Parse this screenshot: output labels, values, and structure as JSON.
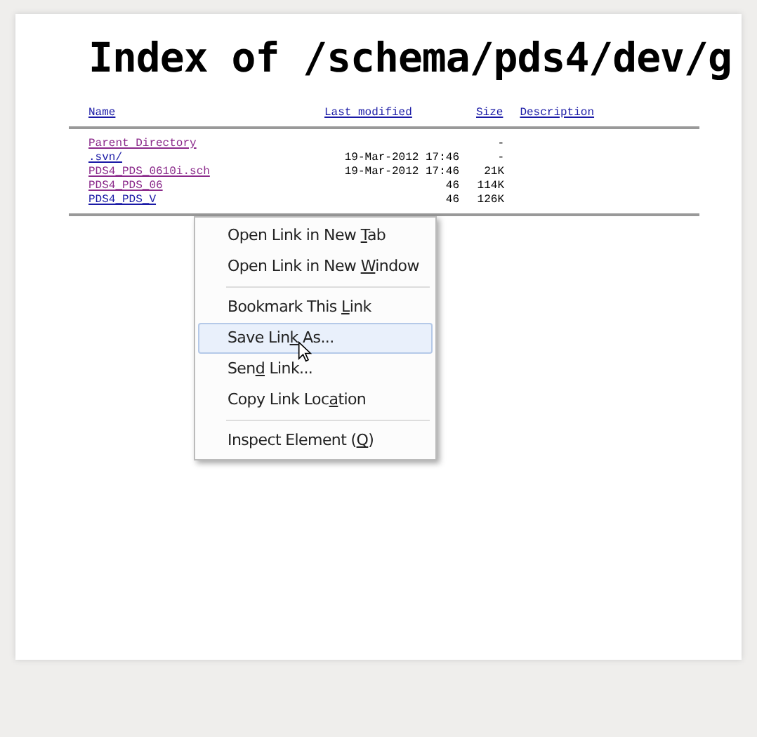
{
  "title": "Index of /schema/pds4/dev/g",
  "columns": [
    "Name",
    "Last modified",
    "Size",
    "Description"
  ],
  "rows": [
    {
      "name": "Parent Directory",
      "modified": "",
      "size": "-",
      "visited": true
    },
    {
      "name": ".svn/",
      "modified": "19-Mar-2012 17:46",
      "size": "-",
      "visited": false
    },
    {
      "name": "PDS4_PDS_0610i.sch",
      "modified": "19-Mar-2012 17:46",
      "size": "21K",
      "visited": true
    },
    {
      "name": "PDS4_PDS_06",
      "modified": "46",
      "size": "114K",
      "visited": true
    },
    {
      "name": "PDS4_PDS_V",
      "modified": "46",
      "size": "126K",
      "visited": false
    }
  ],
  "context_menu": [
    {
      "kind": "item",
      "label_before": "Open Link in New ",
      "accesskey": "T",
      "label_after": "ab",
      "selected": false
    },
    {
      "kind": "item",
      "label_before": "Open Link in New ",
      "accesskey": "W",
      "label_after": "indow",
      "selected": false
    },
    {
      "kind": "separator"
    },
    {
      "kind": "item",
      "label_before": "Bookmark This ",
      "accesskey": "L",
      "label_after": "ink",
      "selected": false
    },
    {
      "kind": "item",
      "label_before": "Save Lin",
      "accesskey": "k",
      "label_after": " As...",
      "selected": true
    },
    {
      "kind": "item",
      "label_before": "Sen",
      "accesskey": "d",
      "label_after": " Link...",
      "selected": false
    },
    {
      "kind": "item",
      "label_before": "Copy Link Loc",
      "accesskey": "a",
      "label_after": "tion",
      "selected": false
    },
    {
      "kind": "separator"
    },
    {
      "kind": "item",
      "label_before": "Inspect Element (",
      "accesskey": "Q",
      "label_after": ")",
      "selected": false
    }
  ]
}
